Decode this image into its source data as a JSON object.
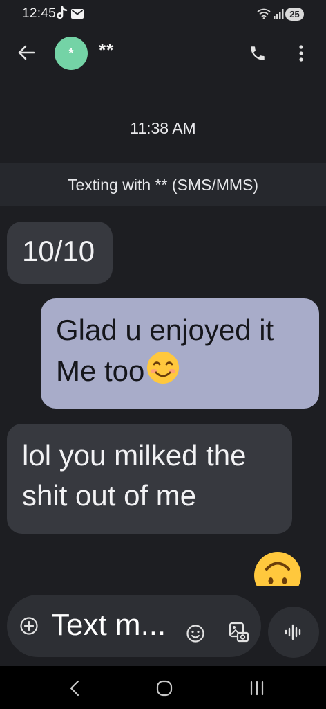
{
  "status_bar": {
    "time": "12:45",
    "battery": "25",
    "icons": [
      "tiktok-icon",
      "mail-icon",
      "wifi-icon",
      "signal-icon"
    ]
  },
  "header": {
    "avatar_glyph": "*",
    "contact_name": "**",
    "avatar_color": "#74d3a6",
    "icons": [
      "back-arrow-icon",
      "phone-icon",
      "more-vert-icon"
    ]
  },
  "conversation": {
    "timestamp": "11:38 AM",
    "texting_with": "Texting with ** (SMS/MMS)",
    "messages": [
      {
        "direction": "incoming",
        "lines": [
          "10/10"
        ]
      },
      {
        "direction": "outgoing",
        "lines": [
          "Glad u enjoyed it",
          "Me too"
        ],
        "trailing_emoji": "smiling-face-icon"
      },
      {
        "direction": "incoming",
        "lines": [
          "lol you milked the",
          "shit out of me"
        ]
      },
      {
        "direction": "outgoing",
        "emoji": "upside-down-face-icon"
      }
    ]
  },
  "compose": {
    "placeholder": "Text m...",
    "icons": [
      "add-circle-icon",
      "emoji-icon",
      "gallery-icon",
      "voice-waveform-icon"
    ]
  },
  "colors": {
    "background": "#1d1e22",
    "incoming_bubble": "#37393f",
    "outgoing_bubble": "#a8acc9",
    "banner": "#26282d",
    "compose": "#2d2f34"
  },
  "nav_bar": {
    "icons": [
      "nav-back-icon",
      "nav-home-icon",
      "nav-recents-icon"
    ]
  }
}
